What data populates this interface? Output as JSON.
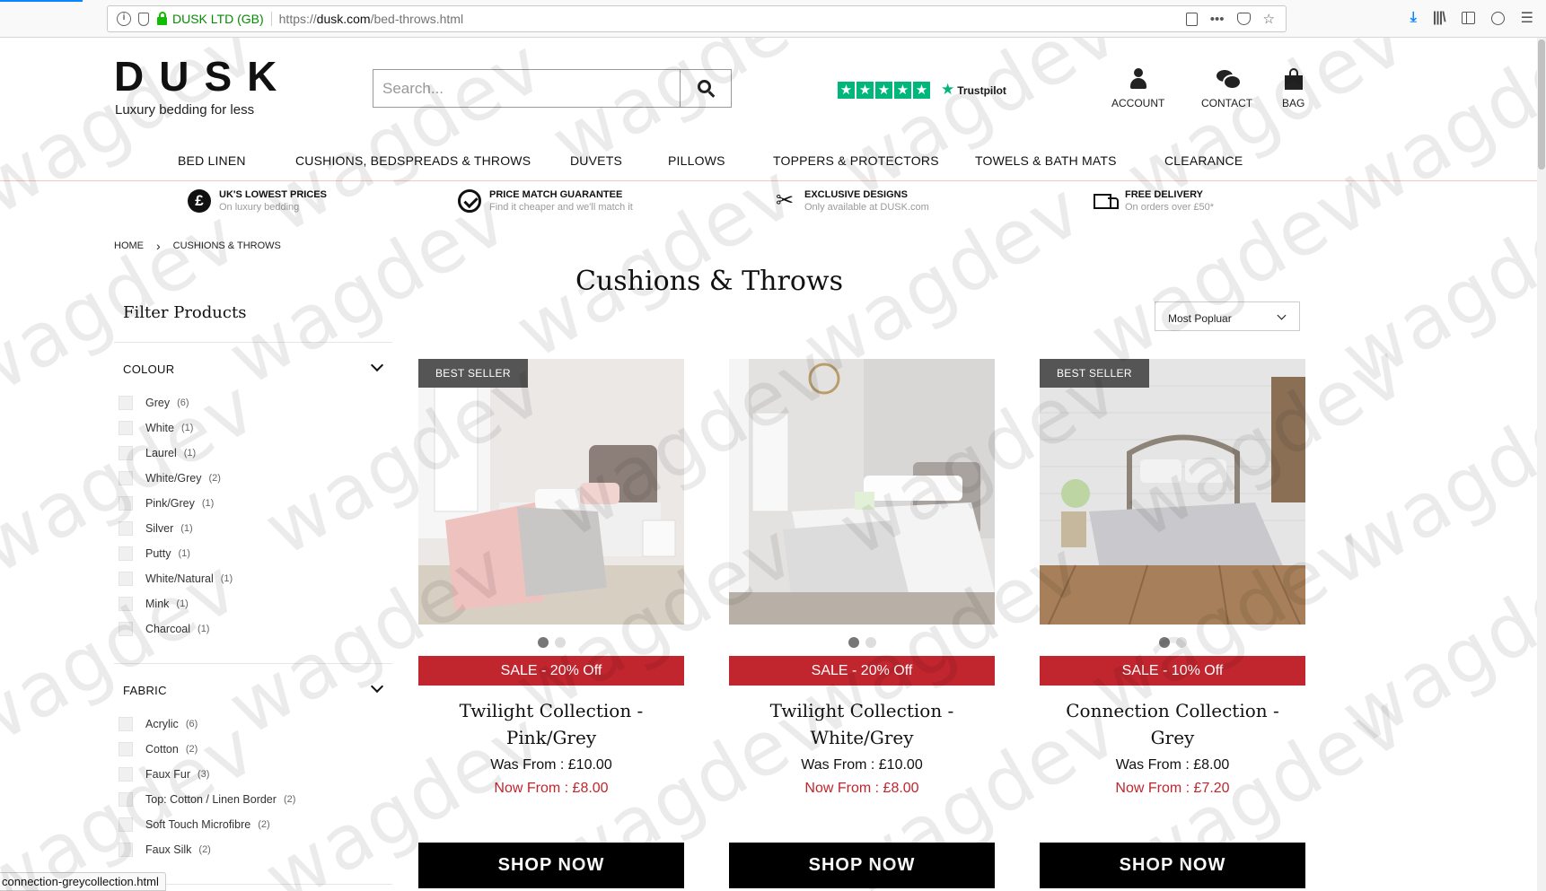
{
  "browser": {
    "org_label": "DUSK LTD (GB)",
    "url_prefix": "https://",
    "url_domain": "dusk.com",
    "url_path": "/bed-throws.html",
    "overflow_menu": "•••",
    "star_glyph": "☆",
    "download_glyph": "⤓",
    "library_glyph": "|||\\",
    "hamburger_glyph": "☰"
  },
  "header": {
    "logo": "DUSK",
    "tagline": "Luxury bedding for less",
    "search_placeholder": "Search...",
    "trustpilot_label": "Trustpilot",
    "links": [
      "ACCOUNT",
      "CONTACT",
      "BAG"
    ]
  },
  "nav": [
    "BED LINEN",
    "CUSHIONS, BEDSPREADS & THROWS",
    "DUVETS",
    "PILLOWS",
    "TOPPERS & PROTECTORS",
    "TOWELS & BATH MATS",
    "CLEARANCE"
  ],
  "usps": [
    {
      "title": "UK'S LOWEST PRICES",
      "sub": "On luxury bedding",
      "icon": "pound-icon"
    },
    {
      "title": "PRICE MATCH GUARANTEE",
      "sub": "Find it cheaper and we'll match it",
      "icon": "check-badge-icon"
    },
    {
      "title": "EXCLUSIVE DESIGNS",
      "sub": "Only available at DUSK.com",
      "icon": "scissors-icon"
    },
    {
      "title": "FREE DELIVERY",
      "sub": "On orders over £50*",
      "icon": "truck-icon"
    }
  ],
  "breadcrumb": [
    "HOME",
    "CUSHIONS & THROWS"
  ],
  "page_title": "Cushions & Throws",
  "filter": {
    "title": "Filter Products",
    "colour_heading": "COLOUR",
    "colour": [
      {
        "label": "Grey",
        "count": "(6)"
      },
      {
        "label": "White",
        "count": "(1)"
      },
      {
        "label": "Laurel",
        "count": "(1)"
      },
      {
        "label": "White/Grey",
        "count": "(2)"
      },
      {
        "label": "Pink/Grey",
        "count": "(1)"
      },
      {
        "label": "Silver",
        "count": "(1)"
      },
      {
        "label": "Putty",
        "count": "(1)"
      },
      {
        "label": "White/Natural",
        "count": "(1)"
      },
      {
        "label": "Mink",
        "count": "(1)"
      },
      {
        "label": "Charcoal",
        "count": "(1)"
      }
    ],
    "fabric_heading": "FABRIC",
    "fabric": [
      {
        "label": "Acrylic",
        "count": "(6)"
      },
      {
        "label": "Cotton",
        "count": "(2)"
      },
      {
        "label": "Faux Fur",
        "count": "(3)"
      },
      {
        "label": "Top: Cotton / Linen Border",
        "count": "(2)"
      },
      {
        "label": "Soft Touch Microfibre",
        "count": "(2)"
      },
      {
        "label": "Faux Silk",
        "count": "(2)"
      }
    ]
  },
  "sort": {
    "selected": "Most Popluar"
  },
  "products": [
    {
      "badge": "BEST SELLER",
      "sale": "SALE - 20% Off",
      "name": "Twilight Collection - Pink/Grey",
      "was": "Was From : £10.00",
      "now": "Now From : £8.00",
      "cta": "SHOP NOW"
    },
    {
      "badge": "",
      "sale": "SALE - 20% Off",
      "name": "Twilight Collection - White/Grey",
      "was": "Was From : £10.00",
      "now": "Now From : £8.00",
      "cta": "SHOP NOW"
    },
    {
      "badge": "BEST SELLER",
      "sale": "SALE - 10% Off",
      "name": "Connection Collection - Grey",
      "was": "Was From : £8.00",
      "now": "Now From : £7.20",
      "cta": "SHOP NOW"
    }
  ],
  "status_url": "connection-greycollection.html",
  "watermark_text": "wagdev",
  "colors": {
    "accent_red": "#c1252e",
    "trustpilot_green": "#00b67a",
    "secure_green": "#058b00"
  }
}
